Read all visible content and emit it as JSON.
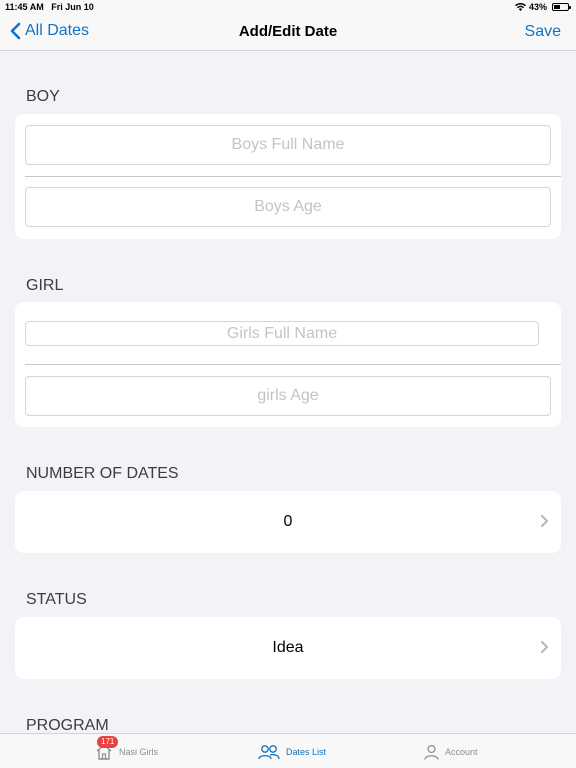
{
  "status_bar": {
    "time": "11:45 AM",
    "date": "Fri Jun 10",
    "battery_percent_label": "43%",
    "battery_level": 0.43
  },
  "nav": {
    "back_label": "All Dates",
    "title": "Add/Edit Date",
    "save_label": "Save"
  },
  "boy": {
    "header": "BOY",
    "name_placeholder": "Boys Full Name",
    "age_placeholder": "Boys Age"
  },
  "girl": {
    "header": "GIRL",
    "name_placeholder": "Girls Full Name",
    "age_placeholder": "girls Age"
  },
  "number_of_dates": {
    "header": "NUMBER OF DATES",
    "value": "0"
  },
  "status": {
    "header": "STATUS",
    "value": "Idea"
  },
  "program": {
    "header": "PROGRAM"
  },
  "tabs": [
    {
      "label": "Nasi Girls",
      "badge": "171",
      "icon": "home-icon",
      "active": false
    },
    {
      "label": "Dates List",
      "icon": "people-icon",
      "active": true
    },
    {
      "label": "Account",
      "icon": "person-icon",
      "active": false
    }
  ],
  "colors": {
    "accent": "#1273c5",
    "background": "#f2f2f7",
    "badge": "#e8413f"
  }
}
